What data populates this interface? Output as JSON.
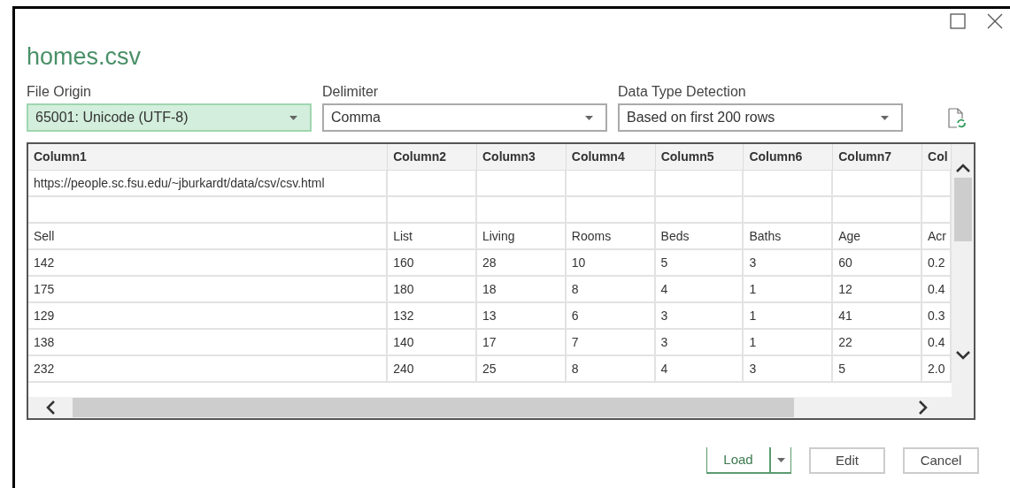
{
  "window": {
    "title": "homes.csv"
  },
  "fields": [
    {
      "label": "File Origin",
      "value": "65001: Unicode (UTF-8)",
      "focused": true
    },
    {
      "label": "Delimiter",
      "value": "Comma",
      "focused": false
    },
    {
      "label": "Data Type Detection",
      "value": "Based on first 200 rows",
      "focused": false
    }
  ],
  "table": {
    "columns": [
      "Column1",
      "Column2",
      "Column3",
      "Column4",
      "Column5",
      "Column6",
      "Column7",
      "Col"
    ],
    "rows": [
      [
        "https://people.sc.fsu.edu/~jburkardt/data/csv/csv.html",
        "",
        "",
        "",
        "",
        "",
        "",
        ""
      ],
      [
        "",
        "",
        "",
        "",
        "",
        "",
        "",
        ""
      ],
      [
        "Sell",
        "List",
        "Living",
        "Rooms",
        "Beds",
        "Baths",
        "Age",
        "Acr"
      ],
      [
        "142",
        "160",
        "28",
        "10",
        "5",
        "3",
        "60",
        "0.2"
      ],
      [
        "175",
        "180",
        "18",
        "8",
        "4",
        "1",
        "12",
        "0.4"
      ],
      [
        "129",
        "132",
        "13",
        "6",
        "3",
        "1",
        "41",
        "0.3"
      ],
      [
        "138",
        "140",
        "17",
        "7",
        "3",
        "1",
        "22",
        "0.4"
      ],
      [
        "232",
        "240",
        "25",
        "8",
        "4",
        "3",
        "5",
        "2.0"
      ]
    ]
  },
  "buttons": [
    {
      "label": "Load",
      "kind": "split"
    },
    {
      "label": "Edit",
      "kind": "plain"
    },
    {
      "label": "Cancel",
      "kind": "plain"
    }
  ]
}
